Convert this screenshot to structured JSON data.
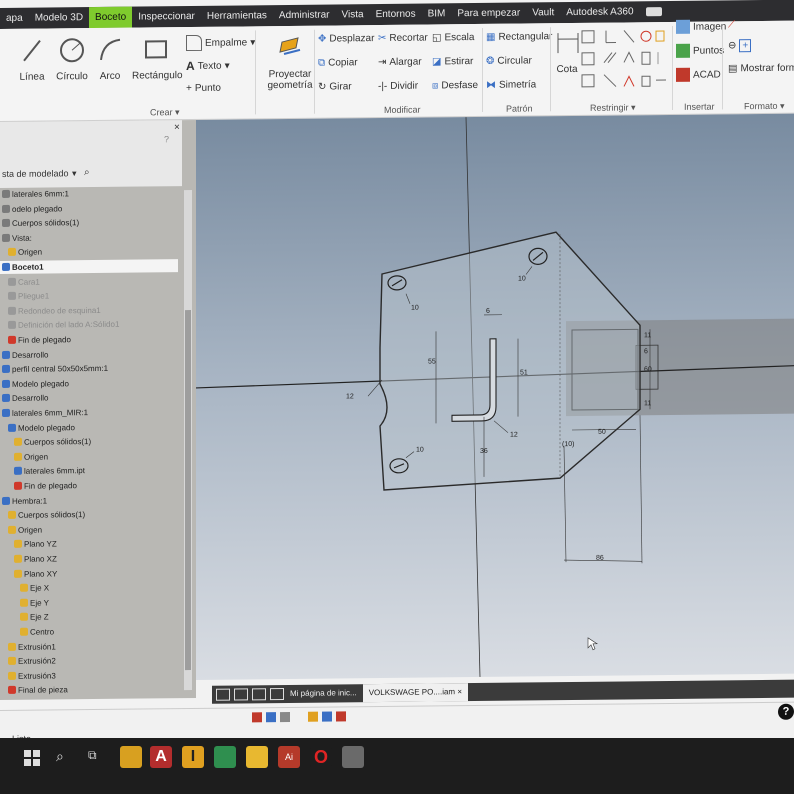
{
  "menubar": {
    "tabs": [
      "apa",
      "Modelo 3D",
      "Boceto",
      "Inspeccionar",
      "Herramientas",
      "Administrar",
      "Vista",
      "Entornos",
      "BIM",
      "Para empezar",
      "Vault",
      "Autodesk A360"
    ],
    "active_index": 2
  },
  "ribbon": {
    "crear": {
      "linea": "Línea",
      "circulo": "Círculo",
      "arco": "Arco",
      "rectangulo": "Rectángulo",
      "empalme": "Empalme",
      "texto": "Texto",
      "punto": "Punto",
      "panel": "Crear"
    },
    "proyectar": {
      "line1": "Proyectar",
      "line2": "geometría"
    },
    "modificar": {
      "desplazar": "Desplazar",
      "copiar": "Copiar",
      "girar": "Girar",
      "recortar": "Recortar",
      "alargar": "Alargar",
      "dividir": "Dividir",
      "escala": "Escala",
      "estirar": "Estirar",
      "desfase": "Desfase",
      "panel": "Modificar"
    },
    "patron": {
      "rectangular": "Rectangular",
      "circular": "Circular",
      "simetria": "Simetría",
      "panel": "Patrón"
    },
    "restringir": {
      "cota": "Cota",
      "panel": "Restringir"
    },
    "insertar": {
      "imagen": "Imagen",
      "puntos": "Puntos",
      "acad": "ACAD",
      "panel": "Insertar"
    },
    "formato": {
      "mostrar": "Mostrar forma",
      "panel": "Formato"
    }
  },
  "browser": {
    "header": "sta de modelado",
    "items": [
      {
        "label": "laterales 6mm:1",
        "indent": 0,
        "style": "normal",
        "icon": "#7a7a7a"
      },
      {
        "label": "odelo plegado",
        "indent": 0,
        "style": "normal",
        "icon": "#7a7a7a"
      },
      {
        "label": "Cuerpos sólidos(1)",
        "indent": 0,
        "style": "normal",
        "icon": "#7a7a7a"
      },
      {
        "label": "Vista:",
        "indent": 0,
        "style": "normal",
        "icon": "#7a7a7a"
      },
      {
        "label": "Origen",
        "indent": 1,
        "style": "normal",
        "icon": "#e0b030"
      },
      {
        "label": "Boceto1",
        "indent": 0,
        "style": "sel",
        "icon": "#3a6fc4"
      },
      {
        "label": "Cara1",
        "indent": 1,
        "style": "dim",
        "icon": "#999"
      },
      {
        "label": "Pliegue1",
        "indent": 1,
        "style": "dim",
        "icon": "#999"
      },
      {
        "label": "Redondeo de esquina1",
        "indent": 1,
        "style": "dim",
        "icon": "#999"
      },
      {
        "label": "Definición del lado A:Sólido1",
        "indent": 1,
        "style": "dim",
        "icon": "#999"
      },
      {
        "label": "Fin de plegado",
        "indent": 1,
        "style": "normal",
        "icon": "#d0392b"
      },
      {
        "label": "Desarrollo",
        "indent": 0,
        "style": "normal",
        "icon": "#3a6fc4"
      },
      {
        "label": "perfil central 50x50x5mm:1",
        "indent": 0,
        "style": "normal",
        "icon": "#3a6fc4"
      },
      {
        "label": "Modelo plegado",
        "indent": 0,
        "style": "normal",
        "icon": "#3a6fc4"
      },
      {
        "label": "Desarrollo",
        "indent": 0,
        "style": "normal",
        "icon": "#3a6fc4"
      },
      {
        "label": "laterales 6mm_MIR:1",
        "indent": 0,
        "style": "normal",
        "icon": "#3a6fc4"
      },
      {
        "label": "Modelo plegado",
        "indent": 1,
        "style": "normal",
        "icon": "#3a6fc4"
      },
      {
        "label": "Cuerpos sólidos(1)",
        "indent": 2,
        "style": "normal",
        "icon": "#e0b030"
      },
      {
        "label": "Origen",
        "indent": 2,
        "style": "normal",
        "icon": "#e0b030"
      },
      {
        "label": "laterales 6mm.ipt",
        "indent": 2,
        "style": "normal",
        "icon": "#3a6fc4"
      },
      {
        "label": "Fin de plegado",
        "indent": 2,
        "style": "normal",
        "icon": "#d0392b"
      },
      {
        "label": "Hembra:1",
        "indent": 0,
        "style": "normal",
        "icon": "#3a6fc4"
      },
      {
        "label": "Cuerpos sólidos(1)",
        "indent": 1,
        "style": "normal",
        "icon": "#e0b030"
      },
      {
        "label": "Origen",
        "indent": 1,
        "style": "normal",
        "icon": "#e0b030"
      },
      {
        "label": "Plano YZ",
        "indent": 2,
        "style": "normal",
        "icon": "#e0b030"
      },
      {
        "label": "Plano XZ",
        "indent": 2,
        "style": "normal",
        "icon": "#e0b030"
      },
      {
        "label": "Plano XY",
        "indent": 2,
        "style": "normal",
        "icon": "#e0b030"
      },
      {
        "label": "Eje X",
        "indent": 3,
        "style": "normal",
        "icon": "#e0b030"
      },
      {
        "label": "Eje Y",
        "indent": 3,
        "style": "normal",
        "icon": "#e0b030"
      },
      {
        "label": "Eje Z",
        "indent": 3,
        "style": "normal",
        "icon": "#e0b030"
      },
      {
        "label": "Centro",
        "indent": 3,
        "style": "normal",
        "icon": "#e0b030"
      },
      {
        "label": "Extrusión1",
        "indent": 1,
        "style": "normal",
        "icon": "#e0b030"
      },
      {
        "label": "Extrusión2",
        "indent": 1,
        "style": "normal",
        "icon": "#e0b030"
      },
      {
        "label": "Extrusión3",
        "indent": 1,
        "style": "normal",
        "icon": "#e0b030"
      },
      {
        "label": "Final de pieza",
        "indent": 1,
        "style": "normal",
        "icon": "#d0392b"
      }
    ]
  },
  "sketch": {
    "dims": {
      "hole_tl": "10",
      "hole_tr": "10",
      "hole_bl": "10",
      "notch_r": "12",
      "d6": "6",
      "d55": "55",
      "d51": "51",
      "d36": "36",
      "d12": "12",
      "d50": "50",
      "d10p": "(10)",
      "d86": "86",
      "d6r": "6",
      "d60": "60",
      "d11a": "11",
      "d11b": "11"
    }
  },
  "doctabs": {
    "home": "Mi página de inic...",
    "doc": "VOLKSWAGE PO....iam"
  },
  "status": {
    "text": "Listo"
  },
  "help": "?"
}
